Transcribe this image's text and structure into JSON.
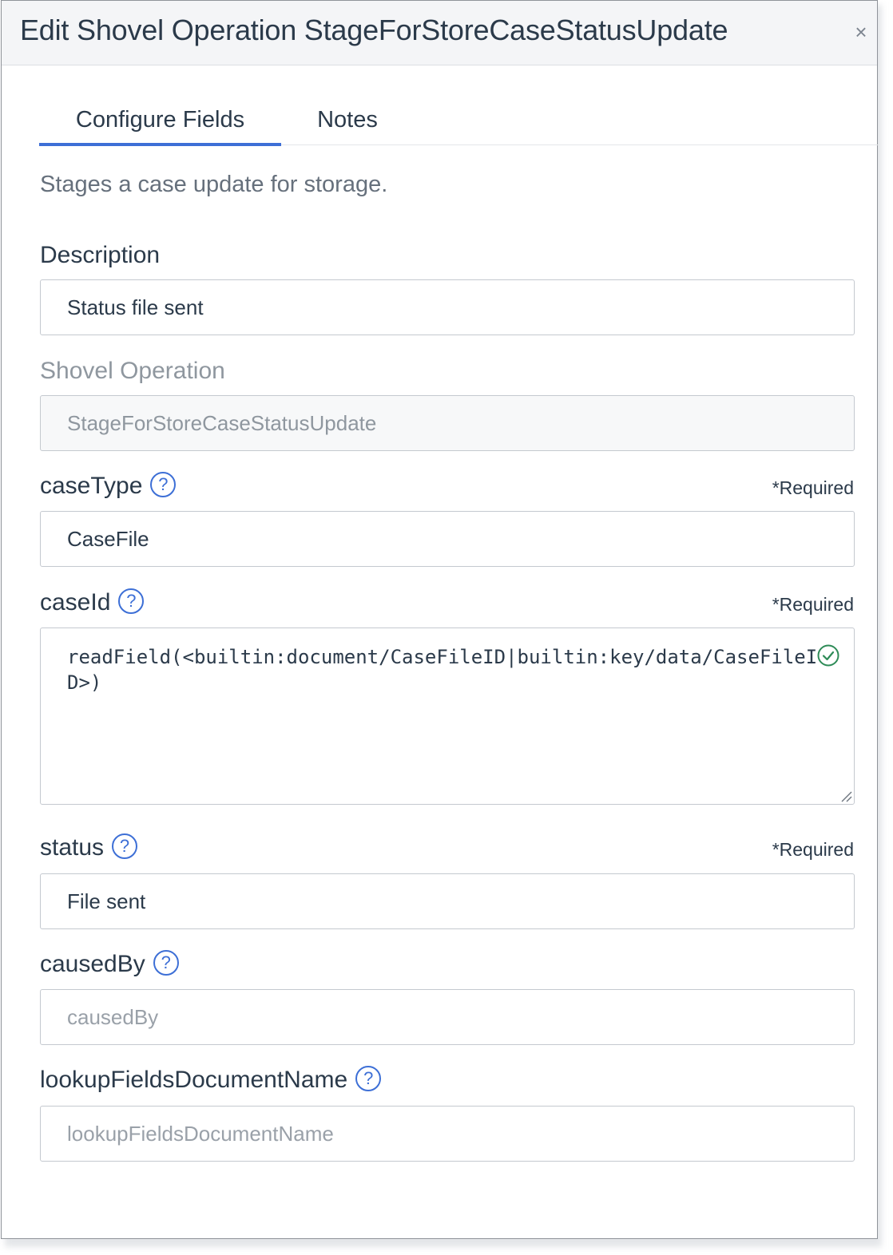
{
  "dialog": {
    "title": "Edit Shovel Operation StageForStoreCaseStatusUpdate",
    "close_label": "×"
  },
  "tabs": [
    {
      "label": "Configure Fields",
      "active": true
    },
    {
      "label": "Notes",
      "active": false
    }
  ],
  "operation_description": "Stages a case update for storage.",
  "fields": {
    "description": {
      "label": "Description",
      "value": "Status file sent"
    },
    "shovel_operation": {
      "label": "Shovel Operation",
      "value": "StageForStoreCaseStatusUpdate"
    },
    "caseType": {
      "label": "caseType",
      "required": "*Required",
      "value": "CaseFile"
    },
    "caseId": {
      "label": "caseId",
      "required": "*Required",
      "value": "readField(<builtin:document/CaseFileID|builtin:key/data/CaseFileID>)"
    },
    "status": {
      "label": "status",
      "required": "*Required",
      "value": "File sent"
    },
    "causedBy": {
      "label": "causedBy",
      "placeholder": "causedBy"
    },
    "lookupFieldsDocumentName": {
      "label": "lookupFieldsDocumentName",
      "placeholder": "lookupFieldsDocumentName"
    }
  },
  "icons": {
    "help": "?",
    "help_color": "#3d6fd6",
    "valid_color": "#2e8b57"
  }
}
